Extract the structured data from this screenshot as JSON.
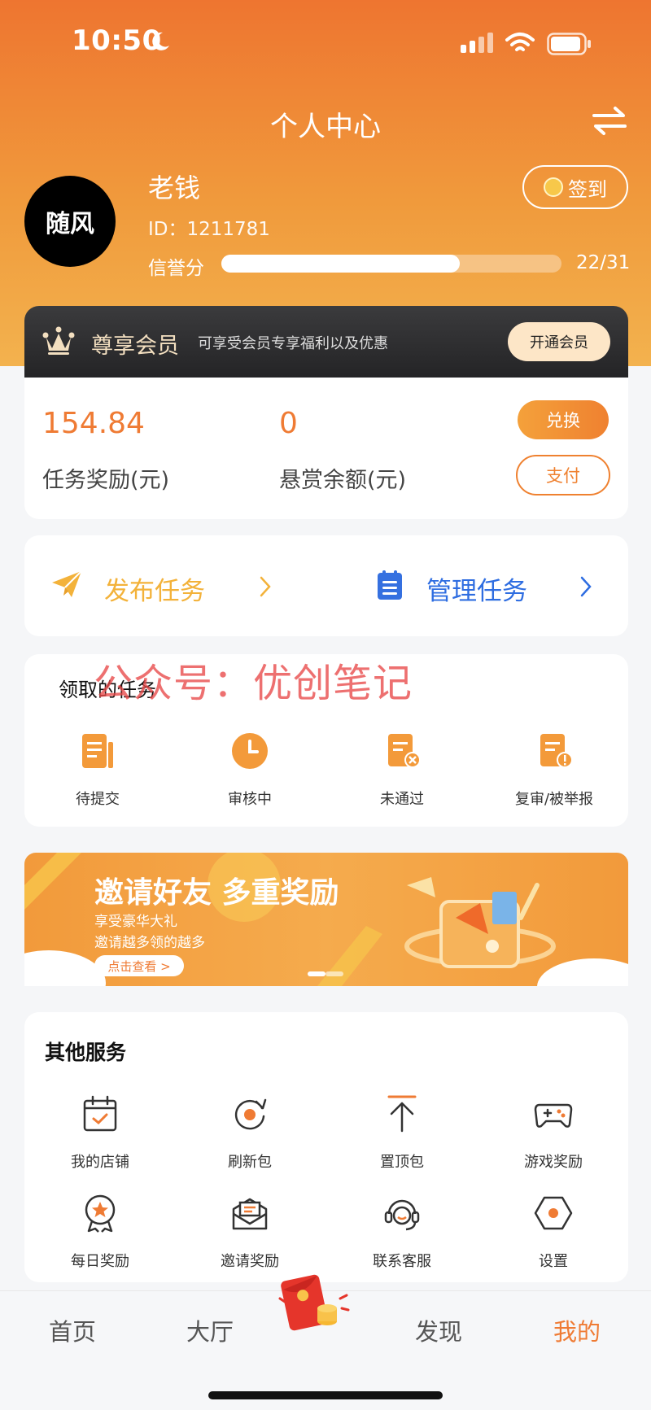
{
  "status_bar": {
    "time": "10:50"
  },
  "header": {
    "title": "个人中心"
  },
  "profile": {
    "avatar_text": "随风",
    "name": "老钱",
    "id_text": "ID：1211781",
    "credit_label": "信誉分",
    "credit_value": "22/31",
    "credit_fraction": 0.7,
    "checkin_label": "签到"
  },
  "vip": {
    "title": "尊享会员",
    "desc": "可享受会员专享福利以及优惠",
    "button": "开通会员"
  },
  "balance": {
    "reward_value": "154.84",
    "reward_label": "任务奖励(元)",
    "bounty_value": "0",
    "bounty_label": "悬赏余额(元)",
    "exchange_label": "兑换",
    "pay_label": "支付"
  },
  "task_actions": {
    "publish_label": "发布任务",
    "manage_label": "管理任务"
  },
  "watermark": "公众号：优创笔记",
  "received_tasks": {
    "title": "领取的任务",
    "items": [
      {
        "label": "待提交"
      },
      {
        "label": "审核中"
      },
      {
        "label": "未通过"
      },
      {
        "label": "复审/被举报"
      }
    ]
  },
  "banner": {
    "title": "邀请好友 多重奖励",
    "subtitle1": "享受豪华大礼",
    "subtitle2": "邀请越多领的越多",
    "button": "点击查看 >"
  },
  "services": {
    "title": "其他服务",
    "items": [
      {
        "label": "我的店铺"
      },
      {
        "label": "刷新包"
      },
      {
        "label": "置顶包"
      },
      {
        "label": "游戏奖励"
      },
      {
        "label": "每日奖励"
      },
      {
        "label": "邀请奖励"
      },
      {
        "label": "联系客服"
      },
      {
        "label": "设置"
      }
    ]
  },
  "tabbar": {
    "tabs": [
      {
        "label": "首页"
      },
      {
        "label": "大厅"
      },
      {
        "label": "发现"
      },
      {
        "label": "我的"
      }
    ],
    "active_tab": "我的"
  },
  "colors": {
    "accent": "#ef7b34",
    "blue": "#2e6de1",
    "gold": "#f3b23a"
  }
}
